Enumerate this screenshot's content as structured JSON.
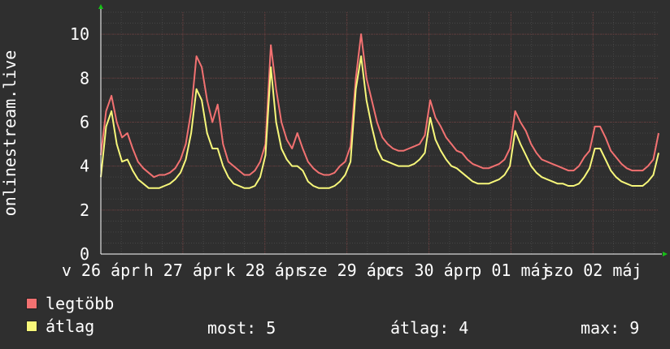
{
  "colors": {
    "background": "#2f2f2f",
    "plot_background": "#2f2f2f",
    "grid_minor": "#454545",
    "grid_major": "#6a3a3a",
    "series_max": "#f27171",
    "series_avg": "#f7f77a",
    "axis_arrow": "#16c016"
  },
  "chart_data": {
    "type": "area",
    "ylabel": "onlinestream.live",
    "ylim": [
      0,
      11
    ],
    "yticks": [
      0,
      2,
      4,
      6,
      8,
      10
    ],
    "grid": true,
    "legend_position": "bottom-left",
    "xticks": [
      "v 26 ápr",
      "h 27 ápr",
      "k 28 ápr",
      "sze 29 ápr",
      "cs 30 ápr",
      "p 01 máj",
      "szo 02 máj"
    ],
    "x_range_days": [
      0,
      6.8
    ],
    "xtick_positions_days": [
      0,
      1,
      2,
      3,
      4,
      5,
      6
    ],
    "series": [
      {
        "name": "legtöbb",
        "color": "#f27171",
        "values": [
          4.5,
          6.5,
          7.2,
          6.0,
          5.3,
          5.5,
          4.8,
          4.2,
          3.9,
          3.7,
          3.5,
          3.6,
          3.6,
          3.7,
          3.9,
          4.3,
          5.0,
          6.5,
          9.0,
          8.5,
          7.0,
          6.0,
          6.8,
          5.0,
          4.2,
          4.0,
          3.8,
          3.6,
          3.6,
          3.8,
          4.2,
          5.0,
          9.5,
          7.5,
          6.0,
          5.2,
          4.8,
          5.5,
          4.8,
          4.2,
          3.9,
          3.7,
          3.6,
          3.6,
          3.7,
          4.0,
          4.2,
          4.9,
          8.0,
          10.0,
          8.0,
          7.0,
          6.0,
          5.3,
          5.0,
          4.8,
          4.7,
          4.7,
          4.8,
          4.9,
          5.0,
          5.4,
          7.0,
          6.2,
          5.8,
          5.3,
          5.0,
          4.7,
          4.6,
          4.3,
          4.1,
          4.0,
          3.9,
          3.9,
          4.0,
          4.1,
          4.3,
          4.8,
          6.5,
          6.0,
          5.6,
          5.0,
          4.6,
          4.3,
          4.2,
          4.1,
          4.0,
          3.9,
          3.8,
          3.8,
          4.0,
          4.4,
          4.7,
          5.8,
          5.8,
          5.3,
          4.7,
          4.4,
          4.1,
          3.9,
          3.8,
          3.8,
          3.8,
          4.0,
          4.3,
          5.5
        ],
        "note": ""
      },
      {
        "name": "átlag",
        "color": "#f7f77a",
        "values": [
          3.5,
          5.8,
          6.5,
          5.0,
          4.2,
          4.3,
          3.8,
          3.4,
          3.2,
          3.0,
          3.0,
          3.0,
          3.1,
          3.2,
          3.4,
          3.7,
          4.3,
          5.5,
          7.5,
          7.0,
          5.5,
          4.8,
          4.8,
          4.0,
          3.5,
          3.2,
          3.1,
          3.0,
          3.0,
          3.1,
          3.5,
          4.5,
          8.5,
          6.0,
          4.8,
          4.3,
          4.0,
          4.0,
          3.8,
          3.3,
          3.1,
          3.0,
          3.0,
          3.0,
          3.1,
          3.3,
          3.6,
          4.2,
          7.5,
          9.0,
          7.0,
          5.8,
          4.8,
          4.3,
          4.2,
          4.1,
          4.0,
          4.0,
          4.0,
          4.1,
          4.3,
          4.6,
          6.2,
          5.2,
          4.7,
          4.3,
          4.0,
          3.9,
          3.7,
          3.5,
          3.3,
          3.2,
          3.2,
          3.2,
          3.3,
          3.4,
          3.6,
          4.0,
          5.6,
          5.0,
          4.5,
          4.0,
          3.7,
          3.5,
          3.4,
          3.3,
          3.2,
          3.2,
          3.1,
          3.1,
          3.2,
          3.5,
          3.9,
          4.8,
          4.8,
          4.3,
          3.8,
          3.5,
          3.3,
          3.2,
          3.1,
          3.1,
          3.1,
          3.3,
          3.6,
          4.6
        ]
      }
    ]
  },
  "legend": {
    "max_label": "legtöbb",
    "avg_label": "átlag"
  },
  "stats": {
    "now": "most: 5",
    "avg": "átlag: 4",
    "max": "max: 9"
  }
}
